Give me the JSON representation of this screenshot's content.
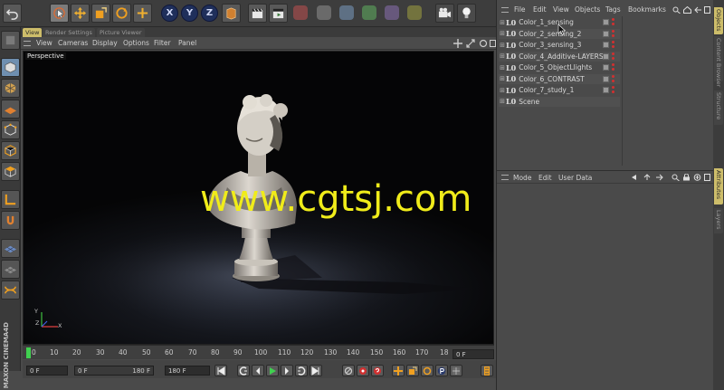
{
  "toolbar": {
    "axis_x": "X",
    "axis_y": "Y",
    "axis_z": "Z"
  },
  "viewport": {
    "tabs": [
      "View",
      "Render Settings",
      "Picture Viewer"
    ],
    "menu": [
      "View",
      "Cameras",
      "Display",
      "Options",
      "Filter",
      "Panel"
    ],
    "label": "Perspective",
    "watermark": "www.cgtsj.com",
    "axis_labels": {
      "y": "Y",
      "z": "Z",
      "x": "X"
    }
  },
  "timeline": {
    "ticks": [
      "0",
      "10",
      "20",
      "30",
      "40",
      "50",
      "60",
      "70",
      "80",
      "90",
      "100",
      "110",
      "120",
      "130",
      "140",
      "150",
      "160",
      "170",
      "18"
    ],
    "current_frame": "0 F"
  },
  "transport": {
    "start_field": "0 F",
    "range_min": "0 F",
    "range_max": "180 F",
    "end_field": "180 F"
  },
  "object_manager": {
    "menu": [
      "File",
      "Edit",
      "View",
      "Objects",
      "Tags",
      "Bookmarks"
    ],
    "objects": [
      {
        "name": "Color_1_sensing"
      },
      {
        "name": "Color_2_sensing_2"
      },
      {
        "name": "Color_3_sensing_3"
      },
      {
        "name": "Color_4_Additive-LAYERS"
      },
      {
        "name": "Color_5_ObjectLlights"
      },
      {
        "name": "Color_6_CONTRAST"
      },
      {
        "name": "Color_7_study_1"
      },
      {
        "name": "Scene"
      }
    ]
  },
  "attributes": {
    "menu": [
      "Mode",
      "Edit",
      "User Data"
    ]
  },
  "side_tabs": [
    "Objects",
    "Content Browser",
    "Structure",
    "Attributes",
    "Layers"
  ],
  "logo": {
    "text": "MAXON CINEMA4D"
  },
  "colors": {
    "accent": "#cdbd6a",
    "axis_button": "#1f2f5b",
    "watermark": "#f0ec1a",
    "tag_red": "#d23030"
  }
}
